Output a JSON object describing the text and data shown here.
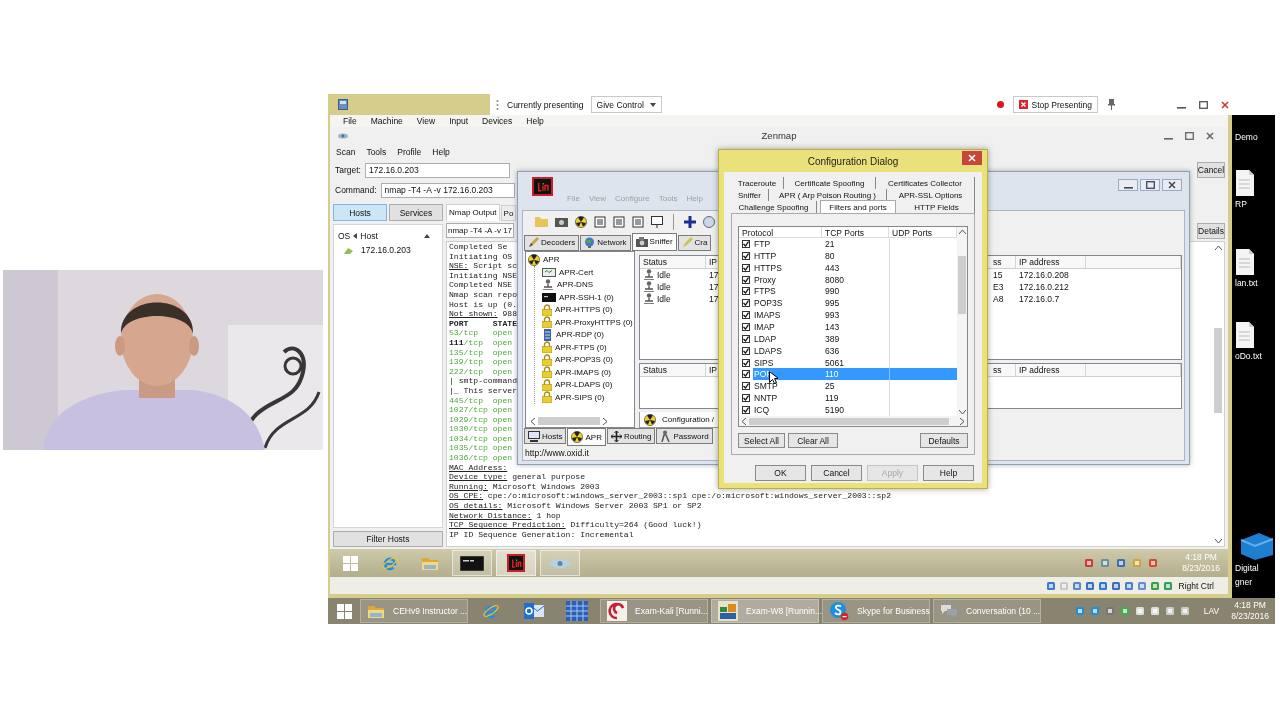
{
  "share_bar": {
    "status": "Currently presenting",
    "give_control": "Give Control",
    "stop": "Stop Presenting"
  },
  "vm_menu": [
    "File",
    "Machine",
    "View",
    "Input",
    "Devices",
    "Help"
  ],
  "zenmap": {
    "title": "Zenmap",
    "menu": [
      "Scan",
      "Tools",
      "Profile",
      "Help"
    ],
    "target_label": "Target:",
    "target": "172.16.0.203",
    "command_label": "Command:",
    "command": "nmap -T4 -A -v 172.16.0.203",
    "cancel": "Cancel",
    "view_tabs": [
      {
        "label": "Hosts",
        "selected": true
      },
      {
        "label": "Services",
        "selected": false
      }
    ],
    "host_header": {
      "os": "OS",
      "host": "Host"
    },
    "hosts": [
      "172.16.0.203"
    ],
    "filter": "Filter Hosts",
    "output_tabs": [
      {
        "label": "Nmap Output",
        "selected": true
      },
      {
        "label": "Po",
        "selected": false
      }
    ],
    "output_command": "nmap -T4 -A -v 17",
    "details": "Details",
    "output": [
      {
        "kind": "plain",
        "text": "Completed Se"
      },
      {
        "kind": "plain",
        "text": "Initiating OS"
      },
      {
        "kind": "label",
        "key": "NSE:",
        "text": " Script sc"
      },
      {
        "kind": "plain",
        "text": "Initiating NSE"
      },
      {
        "kind": "plain",
        "text": "Completed NSE"
      },
      {
        "kind": "plain",
        "text": "Nmap scan repo"
      },
      {
        "kind": "plain",
        "text": "Host is up (0."
      },
      {
        "kind": "label",
        "key": "Not shown:",
        "text": " 988"
      },
      {
        "kind": "header",
        "text": "PORT     STATE"
      },
      {
        "kind": "port",
        "text": "53/tcp   open"
      },
      {
        "kind": "port",
        "key": "111",
        "text": "/tcp  open"
      },
      {
        "kind": "port",
        "text": "135/tcp  open"
      },
      {
        "kind": "port",
        "text": "139/tcp  open"
      },
      {
        "kind": "port",
        "text": "222/tcp  open"
      },
      {
        "kind": "plain",
        "text": "| smtp-command"
      },
      {
        "kind": "plain",
        "text": "|_ This server"
      },
      {
        "kind": "port",
        "text": "445/tcp  open"
      },
      {
        "kind": "port",
        "text": "1027/tcp open"
      },
      {
        "kind": "port",
        "text": "1029/tcp open"
      },
      {
        "kind": "port",
        "text": "1030/tcp open"
      },
      {
        "kind": "port",
        "text": "1034/tcp open"
      },
      {
        "kind": "port",
        "text": "1035/tcp open"
      },
      {
        "kind": "port",
        "text": "1036/tcp open"
      },
      {
        "kind": "label",
        "key": "MAC Address:"
      },
      {
        "kind": "label",
        "key": "Device type:",
        "text": " general purpose"
      },
      {
        "kind": "label",
        "key": "Running:",
        "text": " Microsoft Windows 2003"
      },
      {
        "kind": "label",
        "key": "OS CPE:",
        "text": " cpe:/o:microsoft:windows_server_2003::sp1 cpe:/o:microsoft:windows_server_2003::sp2"
      },
      {
        "kind": "label",
        "key": "OS details:",
        "text": " Microsoft Windows Server 2003 SP1 or SP2"
      },
      {
        "kind": "label",
        "key": "Network Distance:",
        "text": " 1 hop"
      },
      {
        "kind": "label",
        "key": "TCP Sequence Prediction:",
        "text": " Difficulty=264 (Good luck!)"
      },
      {
        "kind": "plain",
        "text": "IP ID Sequence Generation: Incremental"
      }
    ]
  },
  "cain": {
    "menu": [
      "File",
      "View",
      "Configure",
      "Tools",
      "Help"
    ],
    "tabs": [
      {
        "label": "Decoders",
        "kind": "decoders",
        "selected": false
      },
      {
        "label": "Network",
        "kind": "network",
        "selected": false
      },
      {
        "label": "Sniffer",
        "kind": "sniffer",
        "selected": true
      },
      {
        "label": "Cra",
        "kind": "cracker",
        "selected": false
      }
    ],
    "tree": {
      "label": "APR",
      "children": [
        {
          "label": "APR-Cert",
          "kind": "cert"
        },
        {
          "label": "APR-DNS",
          "kind": "dns"
        },
        {
          "label": "APR-SSH-1 (0)",
          "kind": "ssh"
        },
        {
          "label": "APR-HTTPS (0)",
          "kind": "lock"
        },
        {
          "label": "APR-ProxyHTTPS (0)",
          "kind": "lock"
        },
        {
          "label": "APR-RDP (0)",
          "kind": "rdp"
        },
        {
          "label": "APR-FTPS (0)",
          "kind": "lock"
        },
        {
          "label": "APR-POP3S (0)",
          "kind": "lock"
        },
        {
          "label": "APR-IMAPS (0)",
          "kind": "lock"
        },
        {
          "label": "APR-LDAPS (0)",
          "kind": "lock"
        },
        {
          "label": "APR-SIPS (0)",
          "kind": "lock"
        }
      ]
    },
    "upper_columns": [
      "Status",
      "IP",
      "ss",
      "IP address"
    ],
    "upper_rows": [
      {
        "status": "Idle",
        "ip": "17",
        "mac": "15",
        "ip_address": "172.16.0.208"
      },
      {
        "status": "Idle",
        "ip": "17",
        "mac": "E3",
        "ip_address": "172.16.0.212"
      },
      {
        "status": "Idle",
        "ip": "17",
        "mac": "A8",
        "ip_address": "172.16.0.7"
      }
    ],
    "lower_columns": [
      "Status",
      "IP",
      "ss",
      "IP address"
    ],
    "config_tab": "Configuration /",
    "bottom_tabs": [
      {
        "label": "Hosts",
        "kind": "hosts",
        "selected": false
      },
      {
        "label": "APR",
        "kind": "apr",
        "selected": true
      },
      {
        "label": "Routing",
        "kind": "routing",
        "selected": false
      },
      {
        "label": "Password",
        "kind": "password",
        "selected": false
      }
    ],
    "status": "http://www.oxid.it"
  },
  "dialog": {
    "title": "Configuration Dialog",
    "tab_rows": [
      [
        {
          "label": "Traceroute",
          "selected": false
        },
        {
          "label": "Certificate Spoofing",
          "selected": false
        },
        {
          "label": "Certificates Collector",
          "selected": false
        }
      ],
      [
        {
          "label": "Sniffer",
          "selected": false
        },
        {
          "label": "APR ( Arp Poison Routing )",
          "selected": false
        },
        {
          "label": "APR-SSL Options",
          "selected": false
        }
      ],
      [
        {
          "label": "Challenge Spoofing",
          "selected": false
        },
        {
          "label": "Filters and ports",
          "selected": true
        },
        {
          "label": "HTTP Fields",
          "selected": false
        }
      ]
    ],
    "columns": [
      "Protocol",
      "TCP Ports",
      "UDP Ports"
    ],
    "rows": [
      {
        "protocol": "FTP",
        "tcp": "21",
        "checked": true,
        "selected": false
      },
      {
        "protocol": "HTTP",
        "tcp": "80",
        "checked": true,
        "selected": false
      },
      {
        "protocol": "HTTPS",
        "tcp": "443",
        "checked": true,
        "selected": false
      },
      {
        "protocol": "Proxy",
        "tcp": "8080",
        "checked": true,
        "selected": false
      },
      {
        "protocol": "FTPS",
        "tcp": "990",
        "checked": true,
        "selected": false
      },
      {
        "protocol": "POP3S",
        "tcp": "995",
        "checked": true,
        "selected": false
      },
      {
        "protocol": "IMAPS",
        "tcp": "993",
        "checked": true,
        "selected": false
      },
      {
        "protocol": "IMAP",
        "tcp": "143",
        "checked": true,
        "selected": false
      },
      {
        "protocol": "LDAP",
        "tcp": "389",
        "checked": true,
        "selected": false
      },
      {
        "protocol": "LDAPS",
        "tcp": "636",
        "checked": true,
        "selected": false
      },
      {
        "protocol": "SIPS",
        "tcp": "5061",
        "checked": true,
        "selected": false
      },
      {
        "protocol": "POP",
        "tcp": "110",
        "checked": true,
        "selected": true
      },
      {
        "protocol": "SMTP",
        "tcp": "25",
        "checked": true,
        "selected": false
      },
      {
        "protocol": "NNTP",
        "tcp": "119",
        "checked": true,
        "selected": false
      },
      {
        "protocol": "ICQ",
        "tcp": "5190",
        "checked": true,
        "selected": false
      }
    ],
    "list_buttons": [
      "Select All",
      "Clear All",
      "Defaults"
    ],
    "buttons": [
      {
        "label": "OK",
        "disabled": false
      },
      {
        "label": "Cancel",
        "disabled": false
      },
      {
        "label": "Apply",
        "disabled": true
      },
      {
        "label": "Help",
        "disabled": false
      }
    ]
  },
  "vm_taskbar": {
    "apps": [
      {
        "kind": "start",
        "running": false,
        "selected": false
      },
      {
        "kind": "browser",
        "running": false,
        "selected": false
      },
      {
        "kind": "folder",
        "running": false,
        "selected": false
      },
      {
        "kind": "terminal",
        "running": true,
        "selected": false
      },
      {
        "kind": "cain",
        "running": true,
        "selected": true
      },
      {
        "kind": "eye",
        "running": true,
        "selected": false
      }
    ],
    "time": "4:18 PM",
    "date": "8/23/2016"
  },
  "vm_status": {
    "host_key": "Right Ctrl"
  },
  "desktop_icons": [
    {
      "label": "Demo"
    },
    {
      "label": "RP",
      "kind": "document"
    },
    {
      "label": "lan.txt",
      "kind": "document"
    },
    {
      "label": "oDo.txt",
      "kind": "document"
    },
    {
      "label": "Digital",
      "label_2": "gner",
      "kind": "cube"
    }
  ],
  "host_taskbar": {
    "items": [
      {
        "kind": "folder",
        "label": "CEHv9 Instructor ...",
        "selected": false
      },
      {
        "kind": "browser",
        "selected": false
      },
      {
        "kind": "mail",
        "selected": false
      },
      {
        "kind": "grid",
        "selected": false
      },
      {
        "kind": "vm_linux",
        "label": "Exam-Kali [Runni...",
        "selected": false
      },
      {
        "kind": "vm_windows",
        "label": "Exam-W8 [Runnin...",
        "selected": true
      },
      {
        "kind": "chat_app",
        "label": "Skype for Business",
        "selected": false
      },
      {
        "kind": "chat",
        "label": "Conversation (10 ...",
        "selected": false
      }
    ],
    "lang": "LAV",
    "time": "4:18 PM",
    "date": "8/23/2016"
  }
}
